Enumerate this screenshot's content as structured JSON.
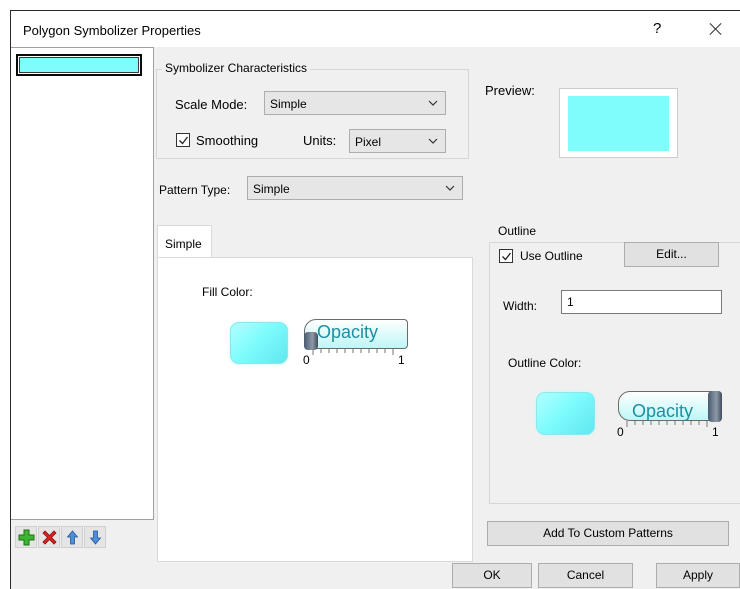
{
  "window": {
    "title": "Polygon Symbolizer Properties",
    "help": "?"
  },
  "colors": {
    "fill": "#7ffcfc",
    "accent_text": "#1d8fa0"
  },
  "symbol_list": {
    "items": [
      {
        "swatch_color": "#7ffcfc",
        "selected": true
      }
    ]
  },
  "list_toolbar": {
    "add_icon": "green-plus-icon",
    "remove_icon": "red-x-icon",
    "up_icon": "arrow-up-icon",
    "down_icon": "arrow-down-icon"
  },
  "characteristics": {
    "legend": "Symbolizer Characteristics",
    "scale_mode_label": "Scale Mode:",
    "scale_mode_value": "Simple",
    "smoothing_label": "Smoothing",
    "smoothing_checked": true,
    "units_label": "Units:",
    "units_value": "Pixel"
  },
  "preview": {
    "label": "Preview:"
  },
  "pattern": {
    "type_label": "Pattern Type:",
    "type_value": "Simple"
  },
  "tab": {
    "label": "Simple"
  },
  "fill": {
    "label": "Fill Color:",
    "opacity_label": "Opacity",
    "opacity_min": "0",
    "opacity_max": "1",
    "opacity_value": 0
  },
  "outline": {
    "legend": "Outline",
    "use_outline_label": "Use Outline",
    "use_outline_checked": true,
    "edit_label": "Edit...",
    "width_label": "Width:",
    "width_value": "1",
    "color_label": "Outline Color:",
    "opacity_label": "Opacity",
    "opacity_min": "0",
    "opacity_max": "1",
    "opacity_value": 1
  },
  "buttons": {
    "add_custom": "Add To Custom Patterns",
    "ok": "OK",
    "cancel": "Cancel",
    "apply": "Apply"
  }
}
